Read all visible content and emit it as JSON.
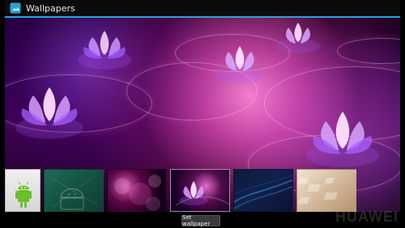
{
  "window": {
    "title": "Wallpapers",
    "icon": "wallpaper-app-icon"
  },
  "thumbnails": [
    {
      "name": "android-green",
      "selected": false
    },
    {
      "name": "android-sketch",
      "selected": false
    },
    {
      "name": "pink-bokeh",
      "selected": false
    },
    {
      "name": "pink-lotus",
      "selected": true
    },
    {
      "name": "blue-waves",
      "selected": false
    },
    {
      "name": "beige-blocks",
      "selected": false
    }
  ],
  "actions": {
    "set_wallpaper_label": "Set wallpaper"
  },
  "watermark": "HUAWEI"
}
